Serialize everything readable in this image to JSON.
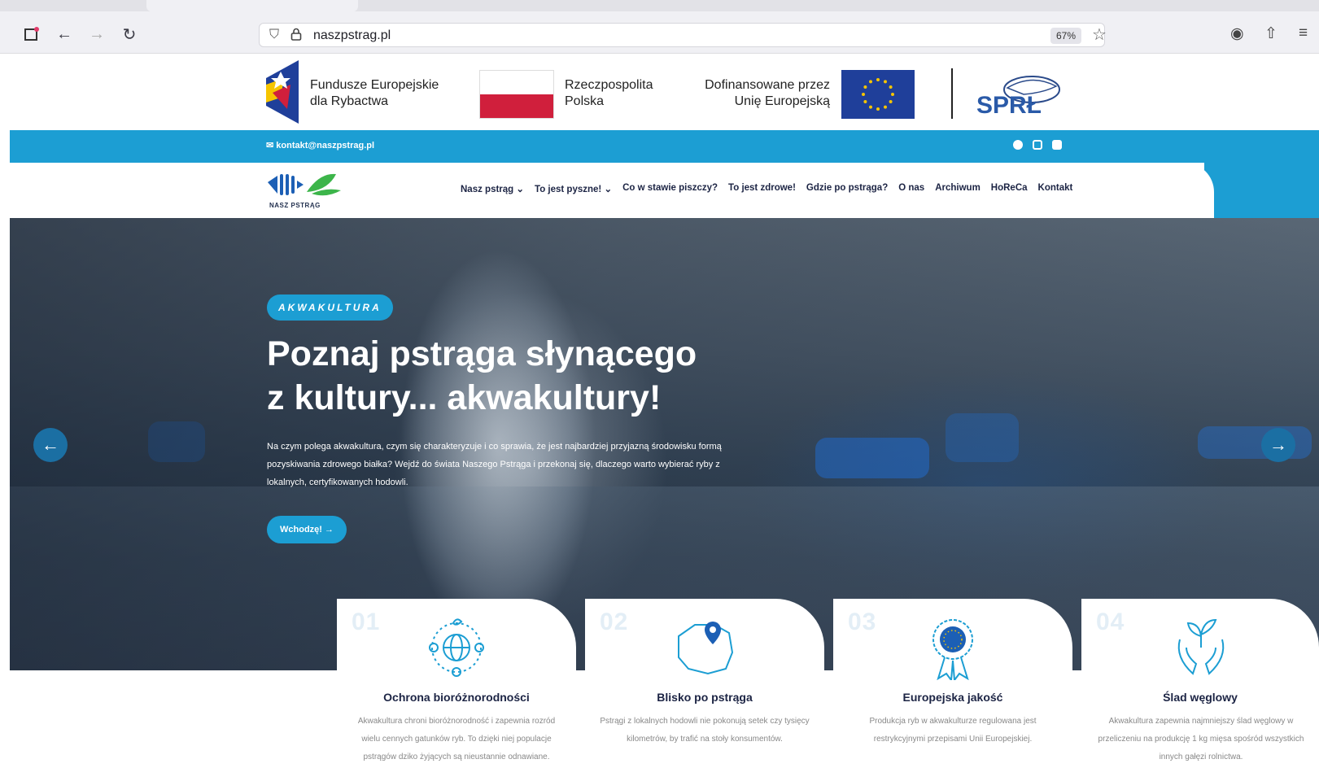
{
  "browser": {
    "url": "naszpstrag.pl",
    "zoom": "67%"
  },
  "funding": {
    "fe_line1": "Fundusze Europejskie",
    "fe_line2": "dla Rybactwa",
    "rp_line1": "Rzeczpospolita",
    "rp_line2": "Polska",
    "eu_line1": "Dofinansowane przez",
    "eu_line2": "Unię Europejską",
    "sprl": "SPRŁ"
  },
  "topbar": {
    "email": "kontakt@naszpstrag.pl"
  },
  "brand": {
    "name": "NASZ PSTRĄG"
  },
  "nav": {
    "items": [
      "Nasz pstrąg ⌄",
      "To jest pyszne! ⌄",
      "Co w stawie piszczy?",
      "To jest zdrowe!",
      "Gdzie po pstrąga?",
      "O nas",
      "Archiwum",
      "HoReCa",
      "Kontakt"
    ]
  },
  "hero": {
    "badge": "AKWAKULTURA",
    "title_line1": "Poznaj pstrąga słynącego",
    "title_line2": "z kultury... akwakultury!",
    "description": "Na czym polega akwakultura, czym się charakteryzuje i co sprawia, że jest najbardziej przyjazną środowisku formą pozyskiwania zdrowego białka? Wejdź do świata Naszego Pstrąga i przekonaj się, dlaczego warto wybierać ryby z lokalnych, certyfikowanych hodowli.",
    "cta": "Wchodzę! →",
    "prev": "←",
    "next": "→"
  },
  "cards": [
    {
      "num": "01",
      "title": "Ochrona bioróżnorodności",
      "desc": "Akwakultura chroni bioróżnorodność i zapewnia rozród wielu cennych gatunków ryb. To dzięki niej populacje pstrągów dziko żyjących są nieustannie odnawiane."
    },
    {
      "num": "02",
      "title": "Blisko po pstrąga",
      "desc": "Pstrągi z lokalnych hodowli nie pokonują setek czy tysięcy kilometrów, by trafić na stoły konsumentów."
    },
    {
      "num": "03",
      "title": "Europejska jakość",
      "desc": "Produkcja ryb w akwakulturze regulowana jest restrykcyjnymi przepisami Unii Europejskiej."
    },
    {
      "num": "04",
      "title": "Ślad węglowy",
      "desc": "Akwakultura zapewnia najmniejszy ślad węglowy w przeliczeniu na produkcję 1 kg mięsa spośród wszystkich innych gałęzi rolnictwa."
    }
  ],
  "colors": {
    "accent": "#1c9ed3",
    "navy": "#1c2444",
    "poland_red": "#d01f3c",
    "eu_blue": "#1f3f9a"
  }
}
